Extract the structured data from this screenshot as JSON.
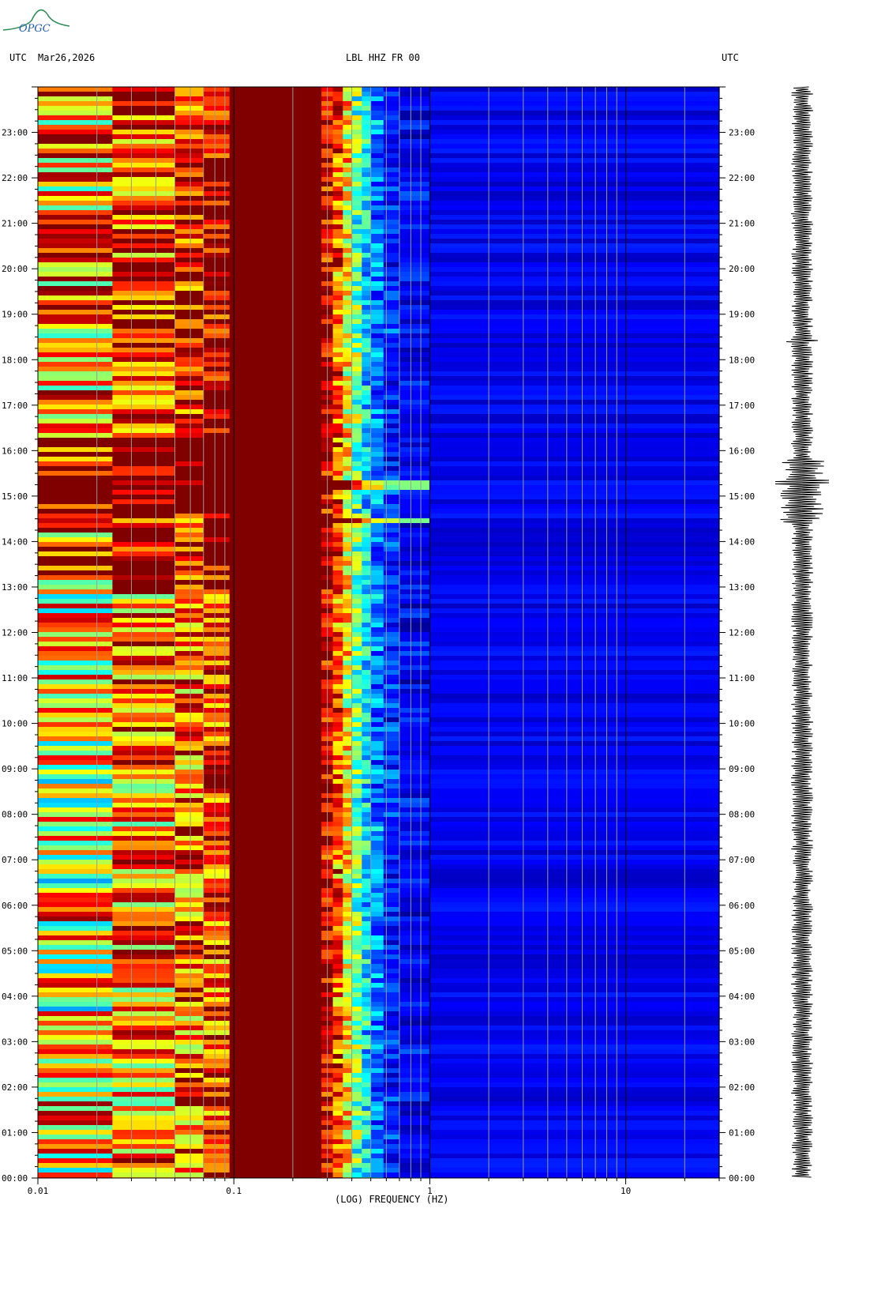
{
  "header": {
    "left_tz": "UTC",
    "date": "Mar26,2026",
    "station": "LBL HHZ FR 00",
    "right_tz": "UTC"
  },
  "logo": {
    "text": "OPGC"
  },
  "colors": {
    "low_power": "#0000a8",
    "high_power": "#800000",
    "trace": "#000000"
  },
  "chart_data": {
    "type": "heatmap",
    "xlabel": "(LOG) FREQUENCY (HZ)",
    "x_scale": "log",
    "x_range": [
      0.01,
      30
    ],
    "x_ticks": [
      "0.01",
      "0.1",
      "1",
      "10"
    ],
    "y_range_hours": [
      0,
      24
    ],
    "y_ticks": [
      "00:00",
      "01:00",
      "02:00",
      "03:00",
      "04:00",
      "05:00",
      "06:00",
      "07:00",
      "08:00",
      "09:00",
      "10:00",
      "11:00",
      "12:00",
      "13:00",
      "14:00",
      "15:00",
      "16:00",
      "17:00",
      "18:00",
      "19:00",
      "20:00",
      "21:00",
      "22:00",
      "23:00"
    ],
    "events_utc_hours": [
      14.5,
      15.3
    ],
    "colormap": "jet"
  }
}
